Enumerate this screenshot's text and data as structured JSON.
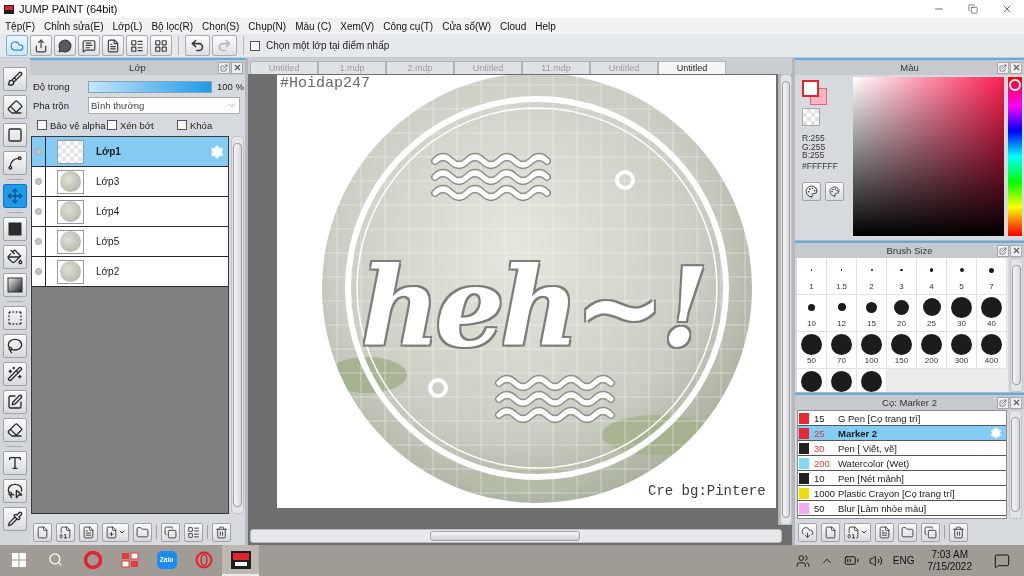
{
  "window": {
    "title": "JUMP PAINT (64bit)"
  },
  "menu": [
    "Tệp(F)",
    "Chỉnh sửa(E)",
    "Lớp(L)",
    "Bộ lọc(R)",
    "Chọn(S)",
    "Chụp(N)",
    "Màu (C)",
    "Xem(V)",
    "Công cụ(T)",
    "Cửa sổ(W)",
    "Cloud",
    "Help"
  ],
  "toolbar": {
    "buttons": [
      {
        "active": true
      },
      {
        "active": false
      },
      {
        "active": false
      },
      {
        "active": false
      },
      {
        "active": false
      },
      {
        "active": false
      },
      {
        "active": false
      }
    ],
    "history": [
      {
        "disabled": false
      },
      {
        "disabled": true
      }
    ],
    "checkbox": {
      "label": "Chọn một lớp tại điểm nhấp",
      "checked": false
    }
  },
  "tool_groups": [
    {
      "tools": [
        {
          "selected": false
        },
        {
          "selected": false
        },
        {
          "selected": false
        },
        {
          "selected": false
        }
      ]
    },
    {
      "tools": [
        {
          "selected": true
        }
      ]
    },
    {
      "tools": [
        {
          "selected": false
        },
        {
          "selected": false
        },
        {
          "selected": false
        }
      ]
    },
    {
      "tools": [
        {
          "selected": false
        },
        {
          "selected": false
        },
        {
          "selected": false
        },
        {
          "selected": false
        },
        {
          "selected": false
        }
      ]
    },
    {
      "tools": [
        {
          "selected": false
        },
        {
          "selected": false
        },
        {
          "selected": false
        }
      ]
    }
  ],
  "layer_panel": {
    "title": "Lớp",
    "opacity": {
      "label": "Độ trong",
      "level": 1,
      "reading": "100 %"
    },
    "blend": {
      "label": "Pha trộn",
      "value": "Bình thường"
    },
    "options": [
      {
        "label": "Bảo vệ alpha",
        "checked": false
      },
      {
        "label": "Xén bớt",
        "checked": false
      },
      {
        "label": "Khóa",
        "checked": false
      }
    ],
    "layers": [
      {
        "name": "Lớp1",
        "kind": "transparent",
        "selected": true
      },
      {
        "name": "Lớp3",
        "kind": "image",
        "selected": false
      },
      {
        "name": "Lớp4",
        "kind": "image",
        "selected": false
      },
      {
        "name": "Lớp5",
        "kind": "image",
        "selected": false
      },
      {
        "name": "Lớp2",
        "kind": "image",
        "selected": false
      }
    ]
  },
  "canvas": {
    "tabs": [
      {
        "label": "Untitled",
        "selected": false
      },
      {
        "label": "1.mdp",
        "selected": false
      },
      {
        "label": "2.mdp",
        "selected": false
      },
      {
        "label": "Untitled",
        "selected": false
      },
      {
        "label": "11.mdp",
        "selected": false
      },
      {
        "label": "Untitled",
        "selected": false
      },
      {
        "label": "Untitled",
        "selected": true
      }
    ],
    "texts": [
      {
        "kind": "tag",
        "text": "#Hoidap247"
      },
      {
        "kind": "lettering",
        "text": "heh~!"
      },
      {
        "kind": "credit",
        "text": "Cre bg:Pintere"
      }
    ]
  },
  "color_panel": {
    "title": "Màu",
    "swatches": [
      {
        "kind": "background",
        "color": "#ffb3be"
      },
      {
        "kind": "foreground",
        "color": "#ffffff"
      }
    ],
    "channels": [
      "R:255",
      "G:255",
      "B:255"
    ],
    "hex": "#FFFFFF"
  },
  "brush_size_panel": {
    "title": "Brush Size",
    "sizes": [
      {
        "kind": "size",
        "label": "1"
      },
      {
        "kind": "size",
        "label": "1.5"
      },
      {
        "kind": "size",
        "label": "2"
      },
      {
        "kind": "size",
        "label": "3"
      },
      {
        "kind": "size",
        "label": "4"
      },
      {
        "kind": "size",
        "label": "5"
      },
      {
        "kind": "size",
        "label": "7"
      },
      {
        "kind": "size",
        "label": "10"
      },
      {
        "kind": "size",
        "label": "12"
      },
      {
        "kind": "size",
        "label": "15"
      },
      {
        "kind": "size",
        "label": "20"
      },
      {
        "kind": "size",
        "label": "25"
      },
      {
        "kind": "size",
        "label": "30"
      },
      {
        "kind": "size",
        "label": "40"
      },
      {
        "kind": "size",
        "label": "50"
      },
      {
        "kind": "size",
        "label": "70"
      },
      {
        "kind": "size",
        "label": "100"
      },
      {
        "kind": "size",
        "label": "150"
      },
      {
        "kind": "size",
        "label": "200"
      },
      {
        "kind": "size",
        "label": "300"
      },
      {
        "kind": "size",
        "label": "400"
      },
      {
        "kind": "cut"
      },
      {
        "kind": "cut"
      },
      {
        "kind": "cut"
      }
    ]
  },
  "brush_panel": {
    "title": "Cọ: Marker 2",
    "brushes": [
      {
        "color": "#e8282c",
        "size": "15",
        "size_modified": false,
        "name": "G Pen [Cọ trang trí]",
        "selected": false
      },
      {
        "color": "#e8282c",
        "size": "25",
        "size_modified": true,
        "name": "Marker 2",
        "selected": true
      },
      {
        "color": "#222222",
        "size": "30",
        "size_modified": true,
        "name": "Pen [ Viết, vẽ]",
        "selected": false
      },
      {
        "color": "#7fd8f2",
        "size": "200",
        "size_modified": true,
        "name": "Watercolor (Wet)",
        "selected": false
      },
      {
        "color": "#222222",
        "size": "10",
        "size_modified": false,
        "name": "Pen [Nét mảnh]",
        "selected": false
      },
      {
        "color": "#f0dc0a",
        "size": "1000",
        "size_modified": false,
        "name": "Plastic Crayon [Cọ trang trí]",
        "selected": false
      },
      {
        "color": "#f8a8f2",
        "size": "50",
        "size_modified": false,
        "name": "Blur [Làm nhòe màu]",
        "selected": false
      }
    ]
  },
  "taskbar": {
    "apps": [
      {
        "kind": "windows",
        "active": false
      },
      {
        "kind": "search",
        "active": false
      },
      {
        "kind": "opera",
        "active": false
      },
      {
        "kind": "tiles",
        "active": false
      },
      {
        "kind": "zalo",
        "text": "Zalo",
        "active": false
      },
      {
        "kind": "opera-gx",
        "active": false
      },
      {
        "kind": "jump-paint",
        "active": true
      }
    ],
    "tray": {
      "language": "ENG",
      "time": "7:03 AM",
      "date": "7/15/2022"
    }
  }
}
